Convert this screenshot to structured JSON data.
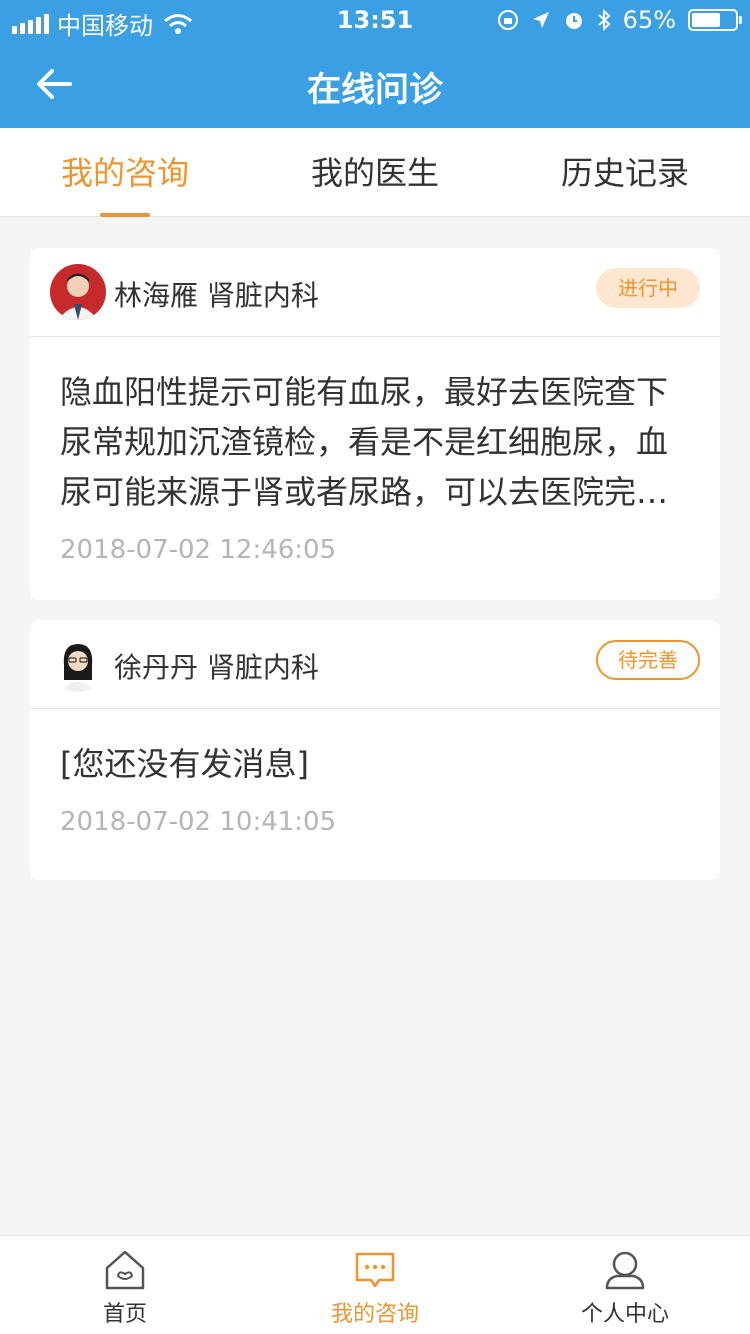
{
  "statusbar": {
    "carrier": "中国移动",
    "time": "13:51",
    "battery": "65%"
  },
  "header": {
    "title": "在线问诊"
  },
  "tabs": [
    {
      "label": "我的咨询",
      "active": true
    },
    {
      "label": "我的医生",
      "active": false
    },
    {
      "label": "历史记录",
      "active": false
    }
  ],
  "consultations": [
    {
      "doctor": "林海雁 肾脏内科",
      "status": "进行中",
      "message": "隐血阳性提示可能有血尿，最好去医院查下尿常规加沉渣镜检，看是不是红细胞尿，血尿可能来源于肾或者尿路，可以去医院完善相关检查。",
      "time": "2018-07-02 12:46:05"
    },
    {
      "doctor": "徐丹丹 肾脏内科",
      "status": "待完善",
      "message": "[您还没有发消息]",
      "time": "2018-07-02 10:41:05"
    }
  ],
  "tabbar": [
    {
      "label": "首页",
      "icon": "home-icon",
      "active": false
    },
    {
      "label": "我的咨询",
      "icon": "chat-icon",
      "active": true
    },
    {
      "label": "个人中心",
      "icon": "person-icon",
      "active": false
    }
  ],
  "colors": {
    "primary": "#3aa0e3",
    "accent": "#f0942d"
  }
}
